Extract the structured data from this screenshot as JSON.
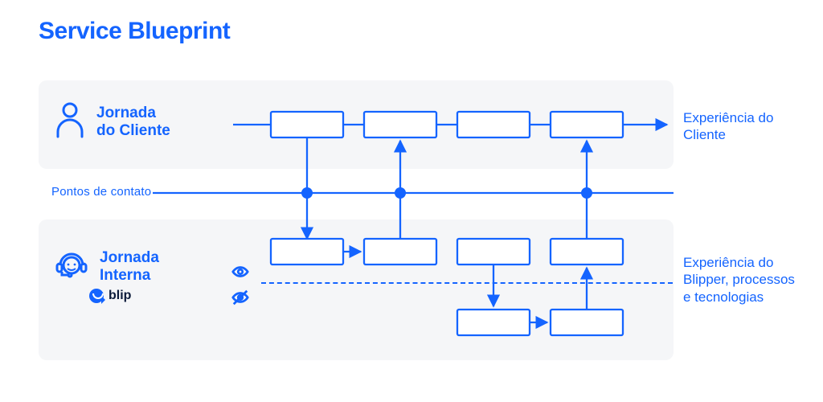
{
  "title": "Service Blueprint",
  "lane_client_label_line1": "Jornada",
  "lane_client_label_line2": "do Cliente",
  "lane_internal_label_line1": "Jornada",
  "lane_internal_label_line2": "Interna",
  "logo_text": "blip",
  "touchpoints_label": "Pontos de contato",
  "right_label_client": "Experiência do Cliente",
  "right_label_internal": "Experiência do Blipper, processos e tecnologias",
  "colors": {
    "primary": "#1464ff",
    "lane_bg": "#f5f6f8"
  },
  "chart_data": {
    "type": "diagram",
    "description": "Service Blueprint with two lanes — Jornada do Cliente (customer journey, top) and Jornada Interna (internal journey, bottom) — connected by a Pontos de contato (touchpoints) line. The internal lane is split by a dashed visibility line into visible (above) and invisible (below) rows.",
    "lanes": [
      {
        "id": "client",
        "label": "Jornada do Cliente",
        "rows": [
          "journey"
        ]
      },
      {
        "id": "internal",
        "label": "Jornada Interna",
        "rows": [
          "visible",
          "invisible"
        ],
        "brand": "blip"
      }
    ],
    "touchpoints_line": {
      "label": "Pontos de contato",
      "touchpoints": [
        "tp1",
        "tp2",
        "tp3"
      ]
    },
    "nodes": [
      {
        "id": "c1",
        "lane": "client",
        "row": "journey",
        "order": 1
      },
      {
        "id": "c2",
        "lane": "client",
        "row": "journey",
        "order": 2
      },
      {
        "id": "c3",
        "lane": "client",
        "row": "journey",
        "order": 3
      },
      {
        "id": "c4",
        "lane": "client",
        "row": "journey",
        "order": 4
      },
      {
        "id": "iv1",
        "lane": "internal",
        "row": "visible",
        "order": 1
      },
      {
        "id": "iv2",
        "lane": "internal",
        "row": "visible",
        "order": 2
      },
      {
        "id": "iv3",
        "lane": "internal",
        "row": "visible",
        "order": 3
      },
      {
        "id": "iv4",
        "lane": "internal",
        "row": "visible",
        "order": 4
      },
      {
        "id": "in1",
        "lane": "internal",
        "row": "invisible",
        "order": 3
      },
      {
        "id": "in2",
        "lane": "internal",
        "row": "invisible",
        "order": 4
      }
    ],
    "edges": [
      {
        "from": "start",
        "to": "c1",
        "kind": "flow"
      },
      {
        "from": "c1",
        "to": "c2",
        "kind": "flow"
      },
      {
        "from": "c2",
        "to": "c3",
        "kind": "flow"
      },
      {
        "from": "c3",
        "to": "c4",
        "kind": "flow"
      },
      {
        "from": "c4",
        "to": "end-arrow",
        "kind": "flow-arrow"
      },
      {
        "from": "c1",
        "to": "tp1",
        "kind": "touchpoint-down"
      },
      {
        "from": "tp1",
        "to": "iv1",
        "kind": "touchpoint-down-arrow"
      },
      {
        "from": "iv2",
        "to": "tp2",
        "kind": "touchpoint-up"
      },
      {
        "from": "tp2",
        "to": "c2",
        "kind": "touchpoint-up-arrow"
      },
      {
        "from": "iv4",
        "to": "tp3",
        "kind": "touchpoint-up"
      },
      {
        "from": "tp3",
        "to": "c4",
        "kind": "touchpoint-up-arrow"
      },
      {
        "from": "iv1",
        "to": "iv2",
        "kind": "flow-arrow"
      },
      {
        "from": "in1",
        "to": "in2",
        "kind": "flow-arrow"
      },
      {
        "from": "iv3",
        "to": "in1",
        "kind": "down-arrow"
      },
      {
        "from": "in2",
        "to": "iv4",
        "kind": "up-arrow"
      }
    ],
    "annotations": [
      {
        "side": "right",
        "lane": "client",
        "text": "Experiência do Cliente"
      },
      {
        "side": "right",
        "lane": "internal",
        "text": "Experiência do Blipper, processos e tecnologias"
      }
    ]
  }
}
